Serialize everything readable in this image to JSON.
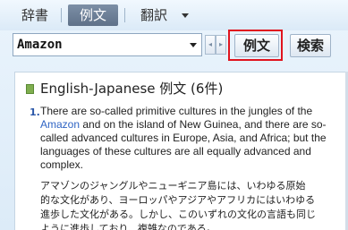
{
  "tabs": [
    {
      "label": "辞書"
    },
    {
      "label": "例文"
    },
    {
      "label": "翻訳"
    }
  ],
  "search": {
    "value": "Amazon"
  },
  "buttons": {
    "example": "例文",
    "search": "検索",
    "prev": "◂",
    "next": "▸"
  },
  "results": {
    "heading": "English-Japanese 例文 (6件)",
    "entries": [
      {
        "number": "1.",
        "en_before": "There are so-called primitive cultures in the jungles of the ",
        "en_link": "Amazon",
        "en_after": " and on the island of New Guinea, and there are so-called advanced cultures in Europe, Asia, and Africa; but the languages of these cultures are all equally advanced and complex.",
        "ja_lines": [
          "アマゾンのジャングルやニューギニア島には、いわゆる原始",
          "的な文化があり、ヨーロッパやアジアやアフリカにはいわゆる",
          "進歩した文化がある。しかし、このいずれの文化の言語も同じ",
          "ように進歩しており、複雑なのである。"
        ]
      }
    ]
  },
  "colors": {
    "highlight": "#e0141e",
    "link": "#2f64c4",
    "active_tab": "#5f7189"
  }
}
